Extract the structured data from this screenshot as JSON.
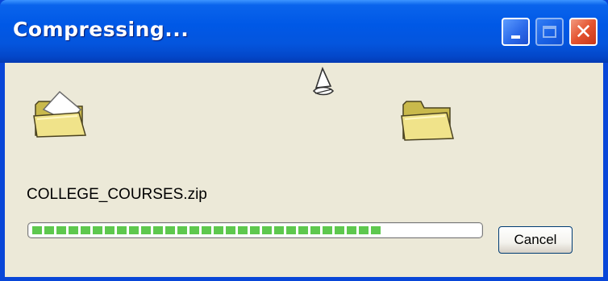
{
  "window": {
    "title": "Compressing...",
    "controls": {
      "minimize_icon": "minimize-icon",
      "maximize_icon": "maximize-icon",
      "close_icon": "close-icon",
      "close_glyph": "✕"
    }
  },
  "animation": {
    "source_icon": "open-folder-icon",
    "flying_item_icon": "flying-document-icon",
    "destination_icon": "folder-icon"
  },
  "file": {
    "name": "COLLEGE_COURSES.zip"
  },
  "progress": {
    "fraction": 0.79
  },
  "buttons": {
    "cancel_label": "Cancel"
  },
  "colors": {
    "titlebar": "#0058e6",
    "client_bg": "#ece9d8",
    "progress_fill": "#5ec84e",
    "close_button": "#e4542f"
  }
}
